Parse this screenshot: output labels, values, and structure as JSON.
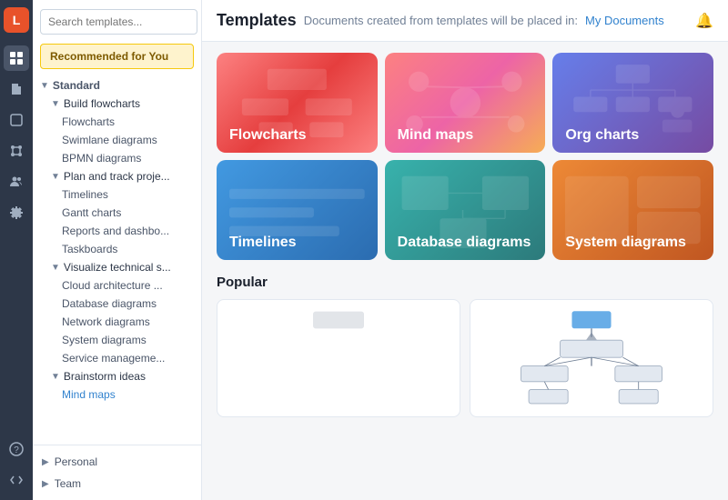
{
  "header": {
    "title": "Templates",
    "subtitle": "Documents created from templates will be placed in:",
    "my_docs_link": "My Documents"
  },
  "search": {
    "placeholder": "Search templates..."
  },
  "sidebar": {
    "recommended_btn": "Recommended for You",
    "tree": [
      {
        "level": 0,
        "label": "Standard",
        "arrow": "▼"
      },
      {
        "level": 1,
        "label": "Build flowcharts",
        "arrow": "▼"
      },
      {
        "level": 2,
        "label": "Flowcharts"
      },
      {
        "level": 2,
        "label": "Swimlane diagrams"
      },
      {
        "level": 2,
        "label": "BPMN diagrams"
      },
      {
        "level": 1,
        "label": "Plan and track proje...",
        "arrow": "▼"
      },
      {
        "level": 2,
        "label": "Timelines"
      },
      {
        "level": 2,
        "label": "Gantt charts"
      },
      {
        "level": 2,
        "label": "Reports and dashbo..."
      },
      {
        "level": 2,
        "label": "Taskboards"
      },
      {
        "level": 1,
        "label": "Visualize technical s...",
        "arrow": "▼"
      },
      {
        "level": 2,
        "label": "Cloud architecture ..."
      },
      {
        "level": 2,
        "label": "Database diagrams"
      },
      {
        "level": 2,
        "label": "Network diagrams"
      },
      {
        "level": 2,
        "label": "System diagrams"
      },
      {
        "level": 2,
        "label": "Service manageme..."
      },
      {
        "level": 1,
        "label": "Brainstorm ideas",
        "arrow": "▼"
      },
      {
        "level": 2,
        "label": "Mind maps"
      }
    ],
    "bottom_items": [
      {
        "label": "Personal",
        "arrow": "▶"
      },
      {
        "label": "Team",
        "arrow": "▶"
      }
    ]
  },
  "categories": [
    {
      "key": "flowcharts",
      "label": "Flowcharts"
    },
    {
      "key": "mindmaps",
      "label": "Mind maps"
    },
    {
      "key": "orgcharts",
      "label": "Org charts"
    },
    {
      "key": "timelines",
      "label": "Timelines"
    },
    {
      "key": "database",
      "label": "Database diagrams"
    },
    {
      "key": "system",
      "label": "System diagrams"
    }
  ],
  "popular_section": {
    "title": "Popular"
  },
  "icons": {
    "logo": "L",
    "home": "⊞",
    "doc": "☰",
    "shape": "◻",
    "puzzle": "⊕",
    "people": "👥",
    "gear": "⚙",
    "help": "?",
    "expand": "≫",
    "bell": "🔔",
    "search": "🔍"
  }
}
